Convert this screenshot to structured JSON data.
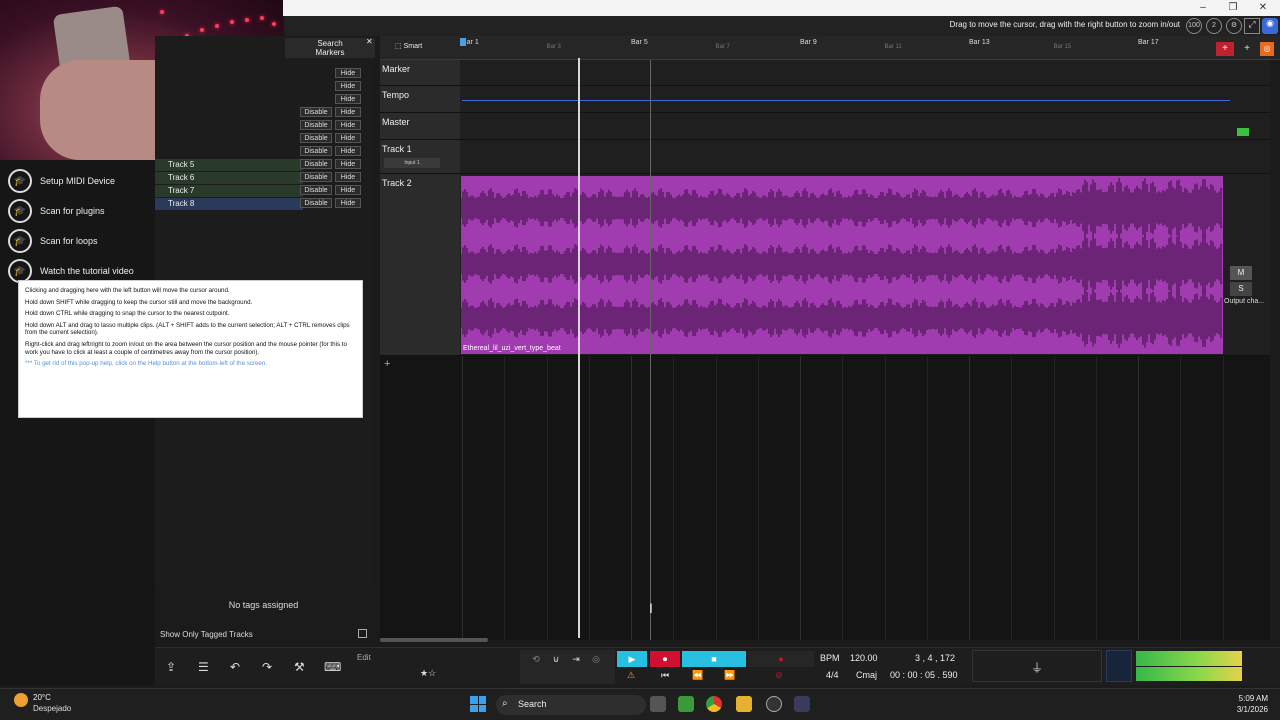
{
  "window": {
    "minimize": "–",
    "maximize": "❐",
    "close": "✕"
  },
  "hint": {
    "text": "Drag to move the cursor, drag with the right button to zoom in/out",
    "zoom_badge": "100",
    "badge2": "2"
  },
  "left_panel": {
    "items": [
      {
        "icon": "graduation-cap-icon",
        "label": "Setup MIDI Device"
      },
      {
        "icon": "graduation-cap-icon",
        "label": "Scan for plugins"
      },
      {
        "icon": "graduation-cap-icon",
        "label": "Scan for loops"
      },
      {
        "icon": "graduation-cap-icon",
        "label": "Watch the tutorial video"
      }
    ]
  },
  "tracks_panel": {
    "search_label": "Search",
    "markers_label": "Markers",
    "rows": [
      {
        "name": "",
        "disable": "",
        "hide": "Hide"
      },
      {
        "name": "",
        "disable": "",
        "hide": "Hide"
      },
      {
        "name": "",
        "disable": "",
        "hide": "Hide"
      },
      {
        "name": "",
        "disable": "Disable",
        "hide": "Hide"
      },
      {
        "name": "",
        "disable": "Disable",
        "hide": "Hide"
      },
      {
        "name": "",
        "disable": "Disable",
        "hide": "Hide"
      },
      {
        "name": "",
        "disable": "Disable",
        "hide": "Hide"
      },
      {
        "name": "Track 5",
        "disable": "Disable",
        "hide": "Hide"
      },
      {
        "name": "Track 6",
        "disable": "Disable",
        "hide": "Hide"
      },
      {
        "name": "Track 7",
        "disable": "Disable",
        "hide": "Hide"
      },
      {
        "name": "Track 8",
        "disable": "Disable",
        "hide": "Hide"
      }
    ],
    "no_tags": "No tags assigned",
    "show_only_tagged": "Show Only Tagged Tracks"
  },
  "help_popup": {
    "lines": [
      "Clicking and dragging here with the left button will move the cursor around.",
      "Hold down SHIFT while dragging to keep the cursor still and move the background.",
      "Hold down CTRL while dragging to snap the cursor to the nearest cutpoint.",
      "Hold down ALT and drag to lasso multiple clips. (ALT + SHIFT adds to the current selection; ALT + CTRL removes clips from the current selection).",
      "Right-click and drag left/right to zoom in/out on the area between the cursor position and the mouse pointer (for this to work you have to click at least a couple of centimetres away from the cursor position)."
    ],
    "note": "*** To get rid of this pop-up help, click on the Help button at the bottom-left of the screen."
  },
  "timeline": {
    "smart_label": "Smart",
    "major_bars": [
      "Bar 1",
      "Bar 5",
      "Bar 9",
      "Bar 13",
      "Bar 17"
    ],
    "minor_bars": [
      "Bar 3",
      "Bar 7",
      "Bar 11",
      "Bar 15"
    ]
  },
  "tracks": [
    {
      "name": "Marker"
    },
    {
      "name": "Tempo"
    },
    {
      "name": "Master"
    },
    {
      "name": "Track 1",
      "input": "Input 1"
    },
    {
      "name": "Track 2"
    }
  ],
  "clip": {
    "name": "Ethereal_lil_uzi_vert_type_beat",
    "color": "#a03bb0"
  },
  "right_side": {
    "m_label": "M",
    "s_label": "S",
    "output": "Output cha..."
  },
  "bottom_toolbar": {
    "edit_label": "Edit"
  },
  "transport": {
    "bpm_label": "BPM",
    "bpm_value": "120.00",
    "time_sig": "4/4",
    "key": "Cmaj",
    "position_bars": "3 , 4 , 172",
    "position_time": "00 : 00 : 05 . 590",
    "record_color": "#d01030",
    "play_color": "#28c0e0"
  },
  "taskbar": {
    "temperature": "20°C",
    "weather": "Despejado",
    "search": "Search",
    "time": "5:09 AM",
    "date": "3/1/2026"
  }
}
